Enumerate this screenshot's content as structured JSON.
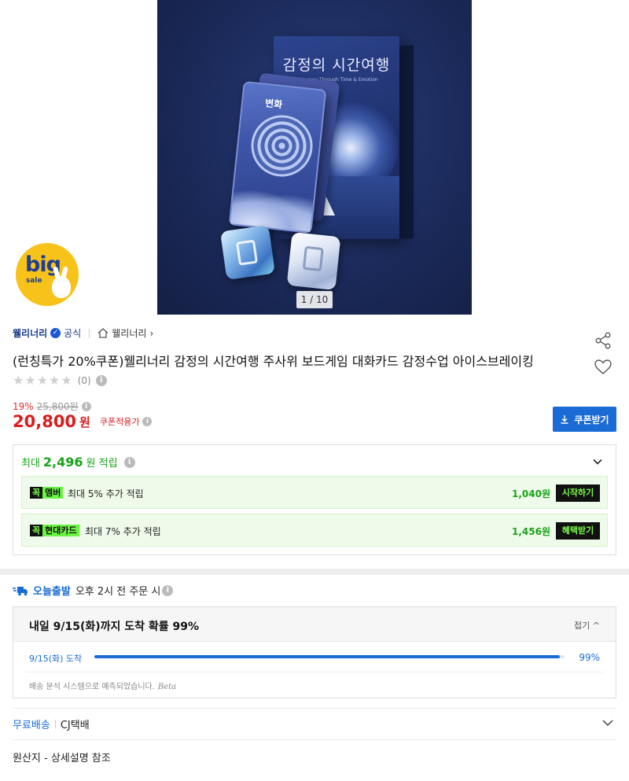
{
  "product_image": {
    "box_title": "감정의 시간여행",
    "box_subtitle": "A Journey Through Time & Emotion",
    "card_text": "변화",
    "counter": "1 / 10"
  },
  "badge": {
    "big": "big",
    "sale": "sale"
  },
  "seller": {
    "name": "웰리너리",
    "official": "공식",
    "store_link": "웰리너리",
    "store_chevron": "›"
  },
  "product": {
    "title": "(런칭특가 20%쿠폰)웰리너리 감정의 시간여행 주사위 보드게임 대화카드 감정수업 아이스브레이킹",
    "stars": "★★★★★",
    "review_count": "(0)"
  },
  "price": {
    "discount_pct": "19%",
    "original": "25,800원",
    "current": "20,800",
    "unit": "원",
    "coupon_applied": "쿠폰적용가",
    "coupon_button": "쿠폰받기"
  },
  "rewards": {
    "prefix": "최대",
    "amount": "2,496",
    "suffix": "원 적립",
    "rows": [
      {
        "tag_k": "꼭",
        "tag_n": "멤버",
        "desc": "최대 5% 추가 적립",
        "points": "1,040원",
        "action": "시작하기"
      },
      {
        "tag_k": "꼭",
        "tag_n": "현대카드",
        "desc": "최대 7% 추가 적립",
        "points": "1,456원",
        "action": "혜택받기"
      }
    ]
  },
  "delivery": {
    "label": "오늘출발",
    "condition": "오후 2시 전 주문 시",
    "eta_title": "내일 9/15(화)까지 도착 확률 99%",
    "toggle": "접기",
    "eta_date": "9/15(화) 도착",
    "eta_pct": "99%",
    "eta_fraction": 0.99,
    "note": "배송 분석 시스템으로 예측되었습니다.",
    "beta": "Beta"
  },
  "shipping": {
    "free": "무료배송",
    "carrier": "CJ택배"
  },
  "origin": "원산지 - 상세설명 참조",
  "colors": {
    "accent": "#1a6bd6",
    "price": "#d81e1e",
    "reward": "#17a317"
  }
}
